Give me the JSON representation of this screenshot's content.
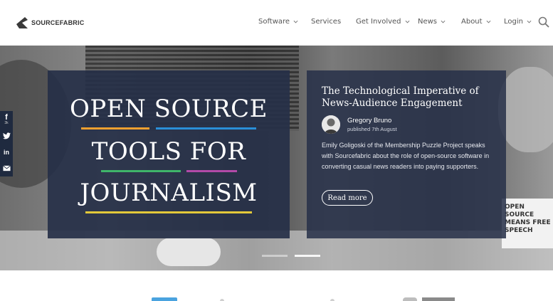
{
  "header": {
    "logo_text": "SOURCEFABRIC",
    "nav": [
      {
        "label": "Software",
        "has_dropdown": true
      },
      {
        "label": "Services",
        "has_dropdown": false
      },
      {
        "label": "Get Involved",
        "has_dropdown": true
      },
      {
        "label": "News",
        "has_dropdown": true
      },
      {
        "label": "About",
        "has_dropdown": true
      },
      {
        "label": "Login",
        "has_dropdown": true
      }
    ],
    "search_icon": "search-icon"
  },
  "hero": {
    "headline_lines": [
      "OPEN SOURCE",
      "TOOLS FOR",
      "JOURNALISM"
    ],
    "underline_colors": [
      "#f0a030",
      "#2a8fd8",
      "#3fb56a",
      "#b24aa8",
      "#e3c93a"
    ],
    "background_shirt_text": "OPEN SOURCE MEANS FREE SPEECH"
  },
  "article": {
    "title": "The Technological Imperative of News-Audience Engagement",
    "author": "Gregory Bruno",
    "date": "published 7th August",
    "summary": "Emily Goligoski of the Membership Puzzle Project speaks with Sourcefabric about the role of open-source software in converting casual news readers into paying supporters.",
    "read_more_label": "Read more"
  },
  "social": {
    "items": [
      {
        "icon": "facebook-icon",
        "glyph": "f",
        "count": "3k"
      },
      {
        "icon": "twitter-icon",
        "glyph": "t"
      },
      {
        "icon": "linkedin-icon",
        "glyph": "in"
      },
      {
        "icon": "email-icon",
        "glyph": "✉"
      }
    ]
  },
  "colors": {
    "panel": "#263048",
    "header_text": "#555555"
  }
}
